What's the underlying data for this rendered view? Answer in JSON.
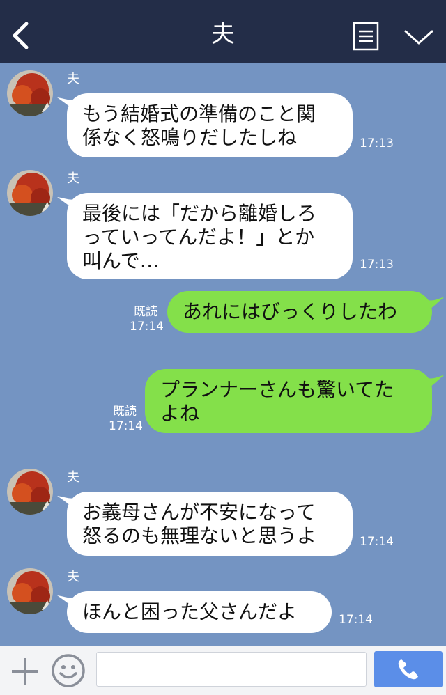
{
  "header": {
    "title": "夫",
    "back_icon": "chevron-left-icon",
    "menu_icon": "document-list-icon",
    "expand_icon": "chevron-down-icon"
  },
  "messages": [
    {
      "from": "夫",
      "side": "in",
      "lines": [
        "もう結婚式の準備のこと関",
        "係なく怒鳴りだしたしね"
      ],
      "time": "17:13"
    },
    {
      "from": "夫",
      "side": "in",
      "lines": [
        "最後には「だから離婚しろ",
        "っていってんだよ！」とか",
        "叫んで…"
      ],
      "time": "17:13"
    },
    {
      "side": "out",
      "lines": [
        "あれにはびっくりしたわ"
      ],
      "read": "既読",
      "time": "17:14"
    },
    {
      "side": "out",
      "lines": [
        "プランナーさんも驚いてた",
        "よね"
      ],
      "read": "既読",
      "time": "17:14"
    },
    {
      "from": "夫",
      "side": "in",
      "lines": [
        "お義母さんが不安になって",
        "怒るのも無理ないと思うよ"
      ],
      "time": "17:14"
    },
    {
      "from": "夫",
      "side": "in",
      "lines": [
        "ほんと困った父さんだよ"
      ],
      "time": "17:14"
    }
  ],
  "footer": {
    "plus_icon": "plus-icon",
    "emoji_icon": "smiley-icon",
    "input_value": "",
    "call_icon": "phone-icon"
  },
  "colors": {
    "header_bg": "#232d48",
    "chat_bg": "#7494c2",
    "outgoing_bubble": "#84e04a",
    "incoming_bubble": "#ffffff",
    "call_button": "#5b8ee8"
  }
}
